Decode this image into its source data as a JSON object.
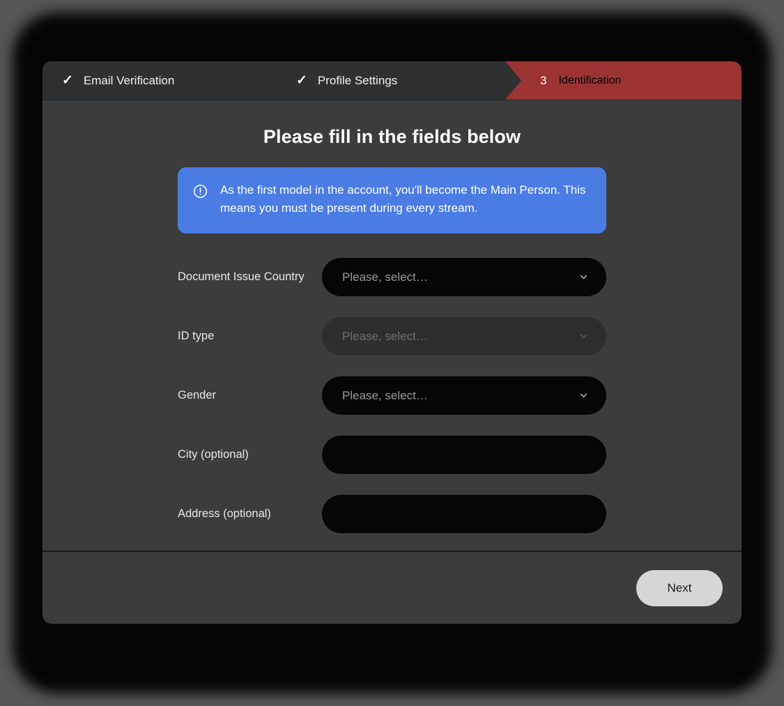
{
  "colors": {
    "page_background": "#565656",
    "frame": "#050505",
    "card_background": "#3c3c3c",
    "header_background": "#2e3032",
    "active_step": "#9c3434",
    "alert_background": "#4a7ce4",
    "field_background": "#060606",
    "field_disabled_background": "#2e2e2e",
    "button_background": "#d6d6d6"
  },
  "steps": [
    {
      "label": "Email Verification",
      "marker": "✓",
      "state": "completed",
      "icon": "check-icon"
    },
    {
      "label": "Profile Settings",
      "marker": "✓",
      "state": "completed",
      "icon": "check-icon"
    },
    {
      "label": "Identification",
      "marker": "3",
      "state": "active",
      "icon": "step-number"
    }
  ],
  "main": {
    "title": "Please fill in the fields below",
    "alert": {
      "icon": "exclamation-circle-icon",
      "text": "As the first model in the account, you'll become the Main Person. This means you must be present during every stream."
    },
    "fields": [
      {
        "label": "Document Issue Country",
        "type": "select",
        "value": "",
        "placeholder": "Please, select…",
        "disabled": false,
        "icon": "chevron-down-icon",
        "name": "document-issue-country"
      },
      {
        "label": "ID type",
        "type": "select",
        "value": "",
        "placeholder": "Please, select…",
        "disabled": true,
        "icon": "chevron-down-icon",
        "name": "id-type"
      },
      {
        "label": "Gender",
        "type": "select",
        "value": "",
        "placeholder": "Please, select…",
        "disabled": false,
        "icon": "chevron-down-icon",
        "name": "gender"
      },
      {
        "label": "City (optional)",
        "type": "text",
        "value": "",
        "placeholder": "",
        "disabled": false,
        "icon": "",
        "name": "city"
      },
      {
        "label": "Address (optional)",
        "type": "text",
        "value": "",
        "placeholder": "",
        "disabled": false,
        "icon": "",
        "name": "address"
      }
    ]
  },
  "footer": {
    "next_label": "Next"
  }
}
